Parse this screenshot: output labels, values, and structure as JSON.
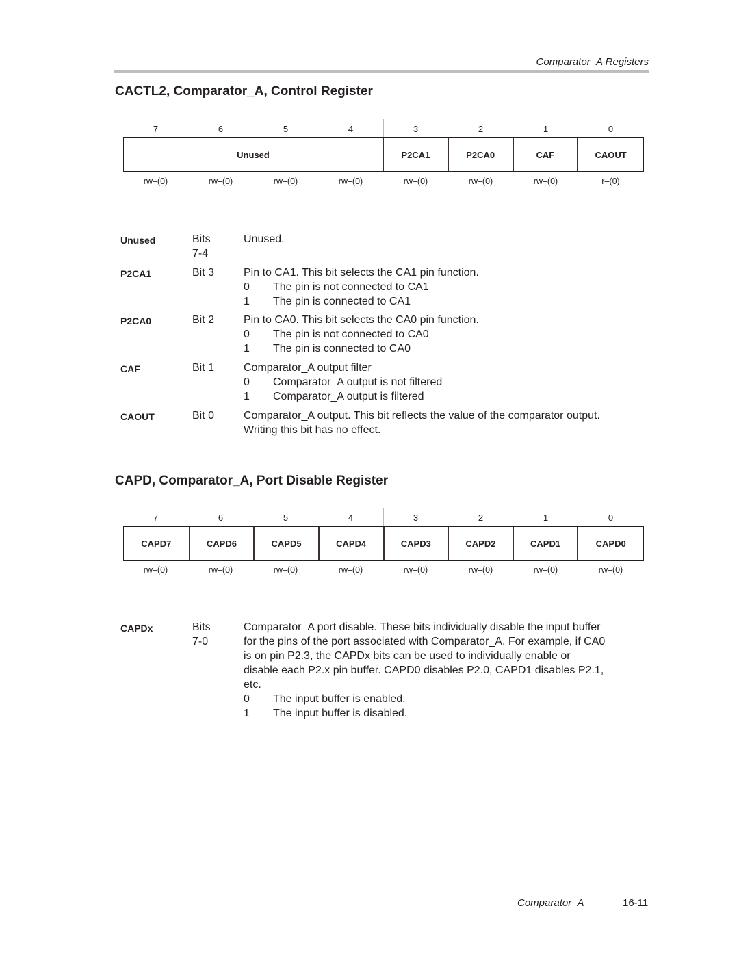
{
  "header": {
    "running_title": "Comparator_A Registers"
  },
  "cactl2": {
    "title": "CACTL2, Comparator_A, Control Register",
    "bit_numbers": [
      "7",
      "6",
      "5",
      "4",
      "3",
      "2",
      "1",
      "0"
    ],
    "fields": [
      {
        "name": "Unused",
        "span": 4
      },
      {
        "name": "P2CA1",
        "span": 1
      },
      {
        "name": "P2CA0",
        "span": 1
      },
      {
        "name": "CAF",
        "span": 1
      },
      {
        "name": "CAOUT",
        "span": 1
      }
    ],
    "access": [
      "rw–(0)",
      "rw–(0)",
      "rw–(0)",
      "rw–(0)",
      "rw–(0)",
      "rw–(0)",
      "rw–(0)",
      "r–(0)"
    ],
    "descriptions": [
      {
        "name": "Unused",
        "bits_line1": "Bits",
        "bits_line2": "7-4",
        "text": "Unused.",
        "options": []
      },
      {
        "name": "P2CA1",
        "bits_line1": "Bit 3",
        "bits_line2": "",
        "text": "Pin to CA1. This bit selects the CA1 pin function.",
        "options": [
          {
            "value": "0",
            "text": "The pin is not connected to CA1"
          },
          {
            "value": "1",
            "text": "The pin is connected to CA1"
          }
        ]
      },
      {
        "name": "P2CA0",
        "bits_line1": "Bit 2",
        "bits_line2": "",
        "text": "Pin to CA0. This bit selects the CA0 pin function.",
        "options": [
          {
            "value": "0",
            "text": "The pin is not connected to CA0"
          },
          {
            "value": "1",
            "text": "The pin is connected to CA0"
          }
        ]
      },
      {
        "name": "CAF",
        "bits_line1": "Bit 1",
        "bits_line2": "",
        "text": "Comparator_A output filter",
        "options": [
          {
            "value": "0",
            "text": "Comparator_A output is not filtered"
          },
          {
            "value": "1",
            "text": "Comparator_A output is filtered"
          }
        ]
      },
      {
        "name": "CAOUT",
        "bits_line1": "Bit 0",
        "bits_line2": "",
        "text": "Comparator_A output. This bit reflects the value of the comparator output.",
        "text2": "Writing this bit has no effect.",
        "options": []
      }
    ]
  },
  "capd": {
    "title": "CAPD, Comparator_A, Port Disable Register",
    "bit_numbers": [
      "7",
      "6",
      "5",
      "4",
      "3",
      "2",
      "1",
      "0"
    ],
    "fields": [
      {
        "name": "CAPD7",
        "span": 1
      },
      {
        "name": "CAPD6",
        "span": 1
      },
      {
        "name": "CAPD5",
        "span": 1
      },
      {
        "name": "CAPD4",
        "span": 1
      },
      {
        "name": "CAPD3",
        "span": 1
      },
      {
        "name": "CAPD2",
        "span": 1
      },
      {
        "name": "CAPD1",
        "span": 1
      },
      {
        "name": "CAPD0",
        "span": 1
      }
    ],
    "access": [
      "rw–(0)",
      "rw–(0)",
      "rw–(0)",
      "rw–(0)",
      "rw–(0)",
      "rw–(0)",
      "rw–(0)",
      "rw–(0)"
    ],
    "description": {
      "name": "CAPDx",
      "bits_line1": "Bits",
      "bits_line2": "7-0",
      "lines": [
        "Comparator_A port disable. These bits individually disable the input buffer",
        "for the pins of the port associated with Comparator_A. For example, if CA0",
        "is on pin P2.3, the CAPDx bits can be used to individually enable or",
        "disable each P2.x pin buffer. CAPD0 disables P2.0, CAPD1 disables P2.1,",
        "etc."
      ],
      "options": [
        {
          "value": "0",
          "text": "The input buffer is enabled."
        },
        {
          "value": "1",
          "text": "The input buffer is disabled."
        }
      ]
    }
  },
  "footer": {
    "chapter": "Comparator_A",
    "page": "16-11"
  }
}
